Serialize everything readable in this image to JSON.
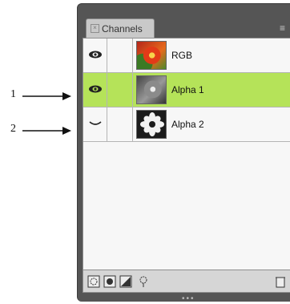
{
  "callouts": [
    {
      "number": "1"
    },
    {
      "number": "2"
    }
  ],
  "panel": {
    "tab_label": "Channels",
    "tab_close_glyph": "×",
    "menu_glyph": "≡"
  },
  "channels": [
    {
      "label": "RGB",
      "visible": true,
      "selected": false,
      "thumbnail": "color-flower"
    },
    {
      "label": "Alpha 1",
      "visible": true,
      "selected": true,
      "thumbnail": "grayscale-flower"
    },
    {
      "label": "Alpha 2",
      "visible": false,
      "selected": false,
      "thumbnail": "flower-mask"
    }
  ],
  "footer": {
    "icons": [
      "load-selection-icon",
      "save-selection-icon",
      "new-channel-icon",
      "dither-icon",
      "delete-channel-icon"
    ],
    "grip": "•••"
  },
  "colors": {
    "panel_bg": "#555555",
    "list_bg": "#f7f7f7",
    "selected_row": "#b5e359"
  }
}
